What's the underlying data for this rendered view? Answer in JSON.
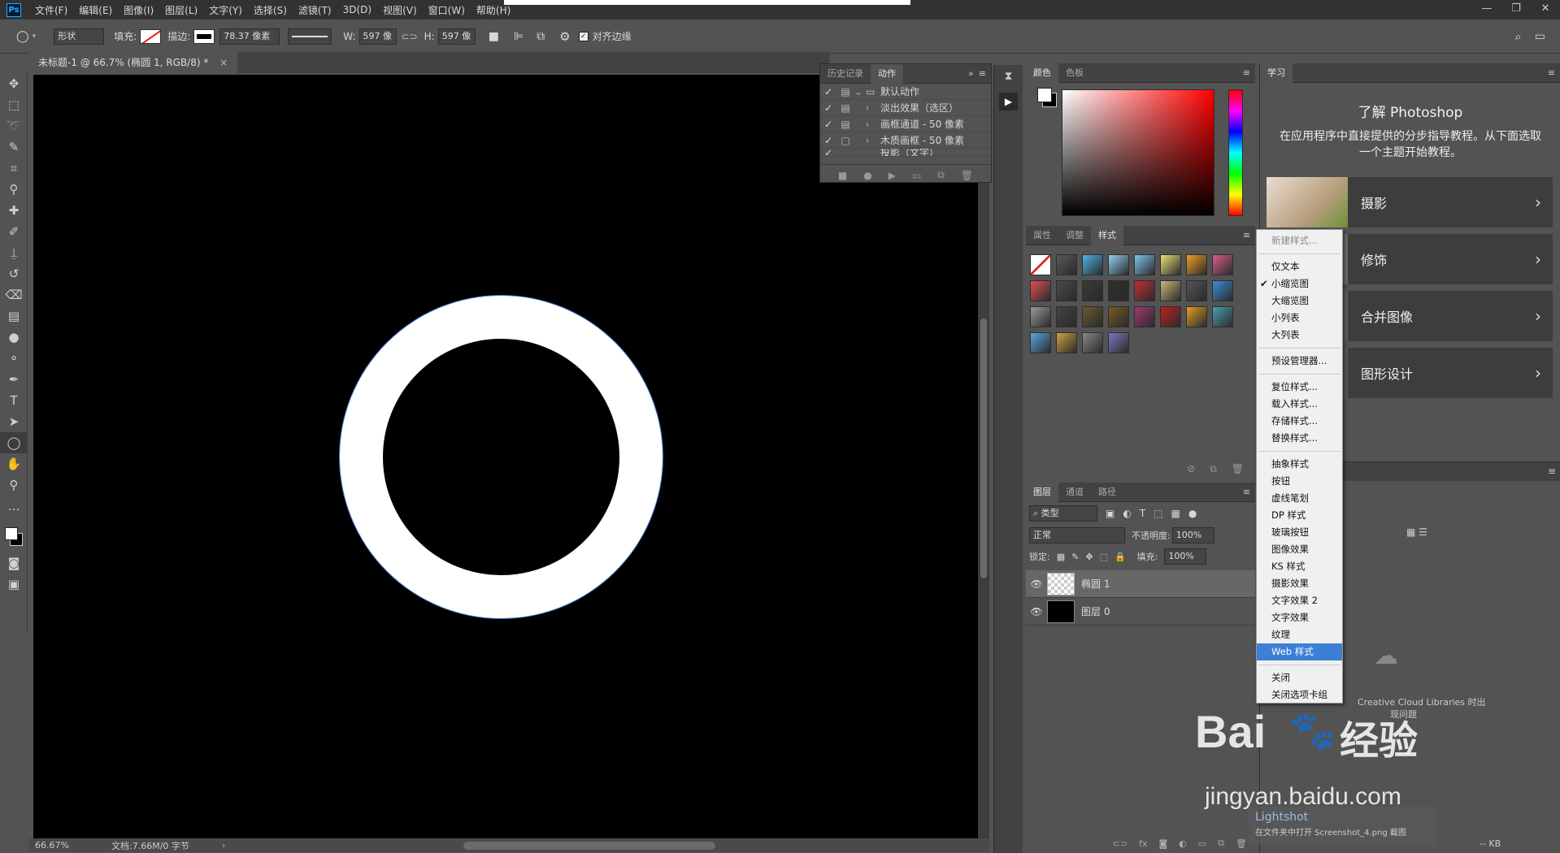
{
  "menubar": {
    "logo": "Ps",
    "items": [
      "文件(F)",
      "编辑(E)",
      "图像(I)",
      "图层(L)",
      "文字(Y)",
      "选择(S)",
      "滤镜(T)",
      "3D(D)",
      "视图(V)",
      "窗口(W)",
      "帮助(H)"
    ],
    "window_controls": [
      "—",
      "❐",
      "✕"
    ]
  },
  "options": {
    "shape_mode": "形状",
    "fill_label": "填充:",
    "stroke_label": "描边:",
    "stroke_width": "78.37 像素",
    "w_label": "W:",
    "w_value": "597 像",
    "h_label": "H:",
    "h_value": "597 像",
    "align_edges": "对齐边缘"
  },
  "document": {
    "tab_title": "未标题-1 @ 66.7% (椭圆 1, RGB/8) *",
    "close": "×",
    "zoom": "66.67%",
    "doc_info": "文档:7.66M/0 字节"
  },
  "history_panel": {
    "tabs": [
      "历史记录",
      "动作"
    ],
    "active_tab": "动作",
    "rows": [
      {
        "check": "✓",
        "name": "默认动作"
      },
      {
        "check": "✓",
        "name": "淡出效果（选区）"
      },
      {
        "check": "✓",
        "name": "画框通道 - 50 像素"
      },
      {
        "check": "✓",
        "name": "木质画框 - 50 像素"
      },
      {
        "check": "✓",
        "name": "投影（文字）"
      }
    ]
  },
  "color_panel": {
    "tabs": [
      "颜色",
      "色板"
    ],
    "active_tab": "颜色"
  },
  "styles_panel": {
    "tabs": [
      "属性",
      "调整",
      "样式"
    ],
    "active_tab": "样式",
    "swatch_colors": [
      "#ffffff",
      "#5a5a5a",
      "#4fb3e8",
      "#8fd0f0",
      "#7fc6ee",
      "#e9e27a",
      "#f0a020",
      "#d95d8c",
      "#e05050",
      "#4a4a4a",
      "#3a3a3a",
      "#2f2f2f",
      "#c03030",
      "#c8b87a",
      "#555555",
      "#3a8fd8",
      "#9a9a9a",
      "#444444",
      "#6a5a30",
      "#7a5a20",
      "#a03a70",
      "#c02020",
      "#e0a020",
      "#4aa0b0",
      "#5aa8e0",
      "#d0a040",
      "#888888",
      "#7a78c0"
    ]
  },
  "layers_panel": {
    "tabs": [
      "图层",
      "通道",
      "路径"
    ],
    "active_tab": "图层",
    "kind_filter": "类型",
    "blend_mode": "正常",
    "opacity_label": "不透明度:",
    "opacity_value": "100%",
    "lock_label": "锁定:",
    "fill_label": "填充:",
    "fill_value": "100%",
    "layers": [
      {
        "name": "椭圆 1"
      },
      {
        "name": "图层 0"
      }
    ]
  },
  "learn_panel": {
    "tab": "学习",
    "heading": "了解 Photoshop",
    "description": "在应用程序中直接提供的分步指导教程。从下面选取一个主题开始教程。",
    "topics": [
      "摄影",
      "修饰",
      "合并图像",
      "图形设计"
    ],
    "cc_text_1": "Creative Cloud Libraries 时出",
    "cc_text_2": "现问题"
  },
  "context_menu": {
    "items": [
      "新建样式...",
      "仅文本",
      "小缩览图",
      "大缩览图",
      "小列表",
      "大列表",
      "预设管理器...",
      "复位样式...",
      "载入样式...",
      "存储样式...",
      "替换样式...",
      "抽象样式",
      "按钮",
      "虚线笔划",
      "DP 样式",
      "玻璃按钮",
      "图像效果",
      "KS 样式",
      "摄影效果",
      "文字效果 2",
      "文字效果",
      "纹理",
      "Web 样式",
      "关闭",
      "关闭选项卡组"
    ],
    "checked": "小缩览图",
    "highlighted": "Web 样式"
  },
  "overlay": {
    "brand_a": "Bai",
    "brand_b": "经验",
    "url": "jingyan.baidu.com",
    "lightshot_title": "Lightshot",
    "lightshot_text": "在文件夹中打开 Screenshot_4.png 截图",
    "kb": "-- KB"
  }
}
